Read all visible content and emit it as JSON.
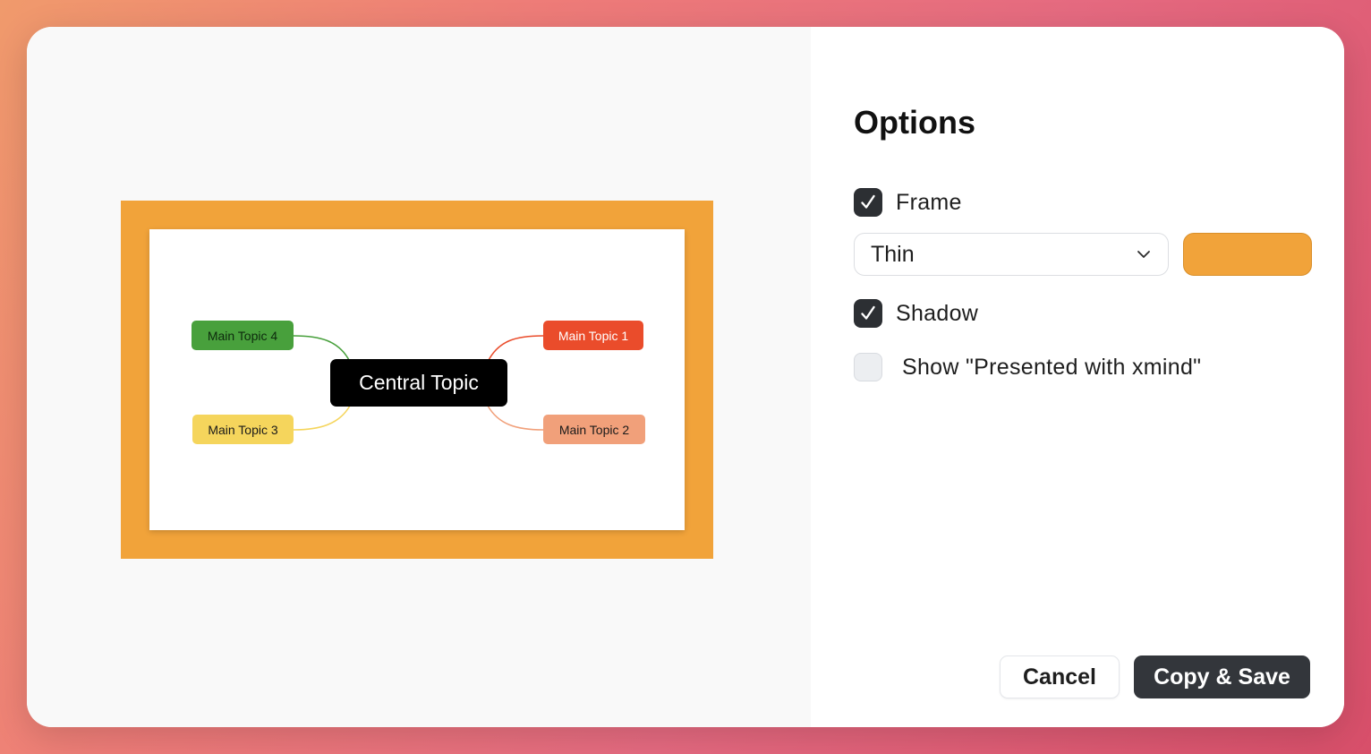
{
  "preview": {
    "central_topic": "Central Topic",
    "topics": [
      {
        "label": "Main Topic 1",
        "color": "#ea4c2b"
      },
      {
        "label": "Main Topic 2",
        "color": "#f1a07a"
      },
      {
        "label": "Main Topic 3",
        "color": "#f5d55c"
      },
      {
        "label": "Main Topic 4",
        "color": "#48a03c"
      }
    ],
    "frame_color": "#f1a33a"
  },
  "options": {
    "title": "Options",
    "frame": {
      "label": "Frame",
      "checked": true
    },
    "frame_style": {
      "value": "Thin",
      "icon": "chevron-down-icon"
    },
    "frame_color": "#f1a33a",
    "shadow": {
      "label": "Shadow",
      "checked": true
    },
    "presented": {
      "label": "Show \"Presented with xmind\"",
      "checked": false
    }
  },
  "buttons": {
    "cancel": "Cancel",
    "save": "Copy & Save"
  }
}
